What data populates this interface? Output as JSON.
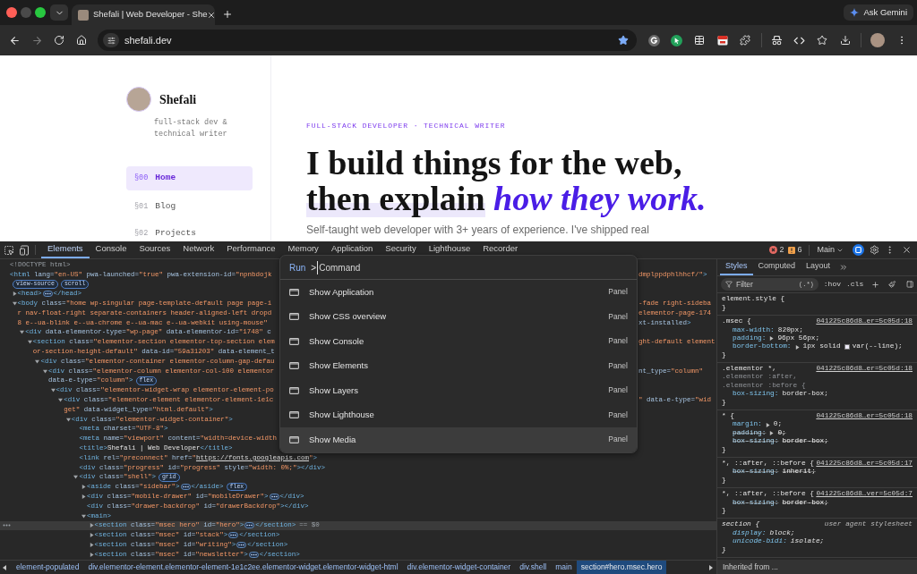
{
  "browser": {
    "tab": {
      "title": "Shefali | Web Developer - She"
    },
    "ask_button": "Ask Gemini",
    "address": "shefali.dev"
  },
  "page": {
    "sidebar": {
      "name": "Shefali",
      "tagline": [
        "full-stack dev &",
        "technical writer"
      ],
      "nav": [
        {
          "number": "§00",
          "label": "Home",
          "selected": true
        },
        {
          "number": "§01",
          "label": "Blog",
          "selected": false
        },
        {
          "number": "§02",
          "label": "Projects",
          "selected": false
        }
      ]
    },
    "hero": {
      "eyebrow": "FULL-STACK DEVELOPER · TECHNICAL WRITER",
      "heading": "I build things for the web,",
      "highlighted": "then explain",
      "emphasis": "how they work.",
      "intro": "Self-taught web developer with 3+ years of experience. I've shipped real"
    }
  },
  "devtools": {
    "tabs": [
      {
        "label": "Elements",
        "selected": true
      },
      {
        "label": "Console",
        "selected": false
      },
      {
        "label": "Sources",
        "selected": false
      },
      {
        "label": "Network",
        "selected": false
      },
      {
        "label": "Performance",
        "selected": false
      },
      {
        "label": "Memory",
        "selected": false
      },
      {
        "label": "Application",
        "selected": false
      },
      {
        "label": "Security",
        "selected": false
      },
      {
        "label": "Lighthouse",
        "selected": false
      },
      {
        "label": "Recorder",
        "selected": false
      }
    ],
    "issues": {
      "errors": "2",
      "warnings": "6"
    },
    "context": "Main",
    "elements": {
      "tree": [
        {
          "lines": [
            {
              "text": "<!DOCTYPE html>",
              "kind": "doctype"
            }
          ],
          "selected": false
        },
        {
          "lines": [
            {
              "text": "<html lang=\"en-US\" pwa-launched=\"true\" pwa-extension-id=\"npnbdojk",
              "kind": "markup",
              "right": {
                "text": "dmplppdphlhhcf/\">",
                "kind": "value"
              }
            },
            {
              "kind": "badges",
              "badges": [
                "view-source",
                "scroll"
              ]
            }
          ],
          "selected": false,
          "children": [
            {
              "lines": [
                {
                  "text": "<head>",
                  "kind": "markup",
                  "ellipsis": true,
                  "after": "</head>"
                }
              ],
              "expanded": false,
              "selected": false
            },
            {
              "lines": [
                {
                  "text": "<body class=\"home wp-singular page-template-default page page-i",
                  "kind": "markup",
                  "right": {
                    "text": "-fade right-sideba",
                    "kind": "value"
                  }
                },
                {
                  "text": "r nav-float-right separate-containers header-aligned-left dropd",
                  "kind": "value",
                  "right": {
                    "text": "elementor-page-174",
                    "kind": "value"
                  }
                },
                {
                  "text": "8 e--ua-blink e--ua-chrome e--ua-mac e--ua-webkit using-mouse\"",
                  "kind": "value",
                  "right": {
                    "text": "xt-installed>",
                    "kind": "attribute"
                  }
                }
              ],
              "expanded": true,
              "selected": false,
              "children": [
                {
                  "lines": [
                    {
                      "text": "<div data-elementor-type=\"wp-page\" data-elementor-id=\"1748\" c",
                      "kind": "markup"
                    }
                  ],
                  "expanded": true,
                  "selected": false,
                  "children": [
                    {
                      "lines": [
                        {
                          "text": "<section class=\"elementor-section elementor-top-section elem",
                          "kind": "markup",
                          "right": {
                            "text": "ght-default element",
                            "kind": "value"
                          }
                        },
                        {
                          "text": "or-section-height-default\" data-id=\"59a31203\" data-element_t",
                          "kind": "value"
                        }
                      ],
                      "expanded": true,
                      "selected": false,
                      "children": [
                        {
                          "lines": [
                            {
                              "text": "<div class=\"elementor-container elementor-column-gap-defau",
                              "kind": "markup"
                            }
                          ],
                          "expanded": true,
                          "selected": false,
                          "children": [
                            {
                              "lines": [
                                {
                                  "text": "<div class=\"elementor-column elementor-col-100 elementor",
                                  "kind": "markup",
                                  "right": {
                                    "text": "nt_type=\"column\"",
                                    "kind": "attribute"
                                  }
                                },
                                {
                                  "text": "data-e-type=\"column\">",
                                  "kind": "attribute",
                                  "badges": [
                                    "flex"
                                  ]
                                }
                              ],
                              "expanded": true,
                              "selected": false,
                              "children": [
                                {
                                  "lines": [
                                    {
                                      "text": "<div class=\"elementor-widget-wrap elementor-element-po",
                                      "kind": "markup"
                                    }
                                  ],
                                  "expanded": true,
                                  "selected": false,
                                  "children": [
                                    {
                                      "lines": [
                                        {
                                          "text": "<div class=\"elementor-element elementor-element-1e1c",
                                          "kind": "markup",
                                          "right": {
                                            "text": "\" data-e-type=\"wid",
                                            "kind": "value"
                                          }
                                        },
                                        {
                                          "text": "get\" data-widget_type=\"html.default\">",
                                          "kind": "value"
                                        }
                                      ],
                                      "expanded": true,
                                      "selected": false,
                                      "children": [
                                        {
                                          "lines": [
                                            {
                                              "text": "<div class=\"elementor-widget-container\">",
                                              "kind": "markup"
                                            }
                                          ],
                                          "expanded": true,
                                          "selected": false,
                                          "children": [
                                            {
                                              "lines": [
                                                {
                                                  "text": "<meta charset=\"UTF-8\">",
                                                  "kind": "markup"
                                                }
                                              ],
                                              "selected": false
                                            },
                                            {
                                              "lines": [
                                                {
                                                  "text": "<meta name=\"viewport\" content=\"width=device-width",
                                                  "kind": "markup"
                                                }
                                              ],
                                              "selected": false
                                            },
                                            {
                                              "lines": [
                                                {
                                                  "text": "<title>Shefali | Web Developer</title>",
                                                  "kind": "markup"
                                                }
                                              ],
                                              "selected": false
                                            },
                                            {
                                              "lines": [
                                                {
                                                  "text": "<link rel=\"preconnect\" href=\"",
                                                  "kind": "markup",
                                                  "link": "https://fonts.googleapis.com",
                                                  "after": "\">"
                                                }
                                              ],
                                              "selected": false
                                            },
                                            {
                                              "lines": [
                                                {
                                                  "text": "<div class=\"progress\" id=\"progress\" style=\"width: 0%;\"></div>",
                                                  "kind": "markup"
                                                }
                                              ],
                                              "selected": false
                                            },
                                            {
                                              "lines": [
                                                {
                                                  "text": "<div class=\"shell\">",
                                                  "kind": "markup",
                                                  "badges": [
                                                    "grid"
                                                  ]
                                                }
                                              ],
                                              "expanded": true,
                                              "selected": false,
                                              "children": [
                                                {
                                                  "lines": [
                                                    {
                                                      "text": "<aside class=\"sidebar\">",
                                                      "kind": "markup",
                                                      "ellipsis": true,
                                                      "after": "</aside>",
                                                      "badges": [
                                                        "flex"
                                                      ]
                                                    }
                                                  ],
                                                  "expanded": false,
                                                  "selected": false
                                                },
                                                {
                                                  "lines": [
                                                    {
                                                      "text": "<div class=\"mobile-drawer\" id=\"mobileDrawer\">",
                                                      "kind": "markup",
                                                      "ellipsis": true,
                                                      "after": "</div>"
                                                    }
                                                  ],
                                                  "expanded": false,
                                                  "selected": false
                                                },
                                                {
                                                  "lines": [
                                                    {
                                                      "text": "<div class=\"drawer-backdrop\" id=\"drawerBackdrop\"></div>",
                                                      "kind": "markup"
                                                    }
                                                  ],
                                                  "selected": false
                                                },
                                                {
                                                  "lines": [
                                                    {
                                                      "text": "<main>",
                                                      "kind": "markup"
                                                    }
                                                  ],
                                                  "expanded": true,
                                                  "selected": false,
                                                  "children": [
                                                    {
                                                      "lines": [
                                                        {
                                                          "text": "<section class=\"msec hero\" id=\"hero\">",
                                                          "kind": "markup",
                                                          "ellipsis": true,
                                                          "after": "</section>",
                                                          "marker": "== $0"
                                                        }
                                                      ],
                                                      "expanded": false,
                                                      "selected": true
                                                    },
                                                    {
                                                      "lines": [
                                                        {
                                                          "text": "<section class=\"msec\" id=\"stack\">",
                                                          "kind": "markup",
                                                          "ellipsis": true,
                                                          "after": "</section>"
                                                        }
                                                      ],
                                                      "expanded": false,
                                                      "selected": false
                                                    },
                                                    {
                                                      "lines": [
                                                        {
                                                          "text": "<section class=\"msec\" id=\"writing\">",
                                                          "kind": "markup",
                                                          "ellipsis": true,
                                                          "after": "</section>"
                                                        }
                                                      ],
                                                      "expanded": false,
                                                      "selected": false
                                                    },
                                                    {
                                                      "lines": [
                                                        {
                                                          "text": "<section class=\"msec\" id=\"newsletter\">",
                                                          "kind": "markup",
                                                          "ellipsis": true,
                                                          "after": "</section>"
                                                        }
                                                      ],
                                                      "expanded": false,
                                                      "selected": false
                                                    }
                                                  ]
                                                }
                                              ]
                                            }
                                          ]
                                        }
                                      ]
                                    }
                                  ]
                                }
                              ]
                            }
                          ]
                        }
                      ]
                    }
                  ]
                }
              ]
            }
          ]
        }
      ],
      "breadcrumbs": [
        {
          "label": "element-populated",
          "selected": false
        },
        {
          "label": "div.elementor-element.elementor-element-1e1c2ee.elementor-widget.elementor-widget-html",
          "selected": false
        },
        {
          "label": "div.elementor-widget-container",
          "selected": false
        },
        {
          "label": "div.shell",
          "selected": false
        },
        {
          "label": "main",
          "selected": false
        },
        {
          "label": "section#hero.msec.hero",
          "selected": true
        }
      ]
    },
    "styles": {
      "tabs": [
        {
          "label": "Styles",
          "selected": true
        },
        {
          "label": "Computed",
          "selected": false
        },
        {
          "label": "Layout",
          "selected": false
        }
      ],
      "filter": {
        "placeholder": "Filter",
        "regex": "(.*)"
      },
      "toggles": [
        ":hov",
        ".cls"
      ],
      "rules": [
        {
          "selector": [
            {
              "text": "element.style {",
              "matched": true
            }
          ],
          "user_agent": false,
          "close": "}"
        },
        {
          "selector": [
            {
              "text": ".msec {",
              "matched": true
            }
          ],
          "source": "041225c86d8…er=5c05d:18",
          "user_agent": false,
          "properties": [
            {
              "name": "max-width:",
              "value": "820px;",
              "shorthand": false,
              "overridden": false
            },
            {
              "name": "padding:",
              "value": "96px 56px;",
              "shorthand": true,
              "overridden": false
            },
            {
              "name": "border-bottom:",
              "value": "1px solid",
              "color": "#ece9f6",
              "variable": "var(--line);",
              "shorthand": true,
              "overridden": false
            }
          ],
          "close": "}"
        },
        {
          "selector": [
            {
              "text": ".elementor *,",
              "matched": true
            },
            {
              "text": ".elementor :after,",
              "matched": false
            },
            {
              "text": ".elementor :before {",
              "matched": false
            }
          ],
          "source": "041225c86d8…er=5c05d:18",
          "user_agent": false,
          "properties": [
            {
              "name": "box-sizing:",
              "value": "border-box;",
              "shorthand": false,
              "overridden": false
            }
          ],
          "close": "}"
        },
        {
          "selector": [
            {
              "text": "* {",
              "matched": true
            }
          ],
          "source": "041225c86d8…er=5c05d:18",
          "user_agent": false,
          "properties": [
            {
              "name": "margin:",
              "value": "0;",
              "shorthand": true,
              "overridden": false
            },
            {
              "name": "padding:",
              "value": "0;",
              "shorthand": true,
              "overridden": true
            },
            {
              "name": "box-sizing:",
              "value": "border-box;",
              "shorthand": false,
              "overridden": true
            }
          ],
          "close": "}"
        },
        {
          "selector": [
            {
              "text": "*, ::after, ::before {",
              "matched": true
            }
          ],
          "source": "041225c86d8…er=5c05d:17",
          "user_agent": false,
          "properties": [
            {
              "name": "box-sizing:",
              "value": "inherit;",
              "shorthand": false,
              "overridden": true
            }
          ],
          "close": "}"
        },
        {
          "selector": [
            {
              "text": "*, ::after, ::before {",
              "matched": true
            }
          ],
          "source": "041225c86d8…ver=5c05d:7",
          "user_agent": false,
          "properties": [
            {
              "name": "box-sizing:",
              "value": "border-box;",
              "shorthand": false,
              "overridden": true
            }
          ],
          "close": "}"
        },
        {
          "selector": [
            {
              "text": "section {",
              "matched": true
            }
          ],
          "source": "user agent stylesheet",
          "user_agent": true,
          "properties": [
            {
              "name": "display:",
              "value": "block;",
              "shorthand": false,
              "overridden": false
            },
            {
              "name": "unicode-bidi:",
              "value": "isolate;",
              "shorthand": false,
              "overridden": false
            }
          ],
          "close": "}"
        }
      ],
      "inherited": "Inherited from ..."
    },
    "command_menu": {
      "prefix": "Run",
      "value": ">",
      "placeholder": "Command",
      "items": [
        {
          "label": "Show Application",
          "category": "Panel",
          "selected": false
        },
        {
          "label": "Show CSS overview",
          "category": "Panel",
          "selected": false
        },
        {
          "label": "Show Console",
          "category": "Panel",
          "selected": false
        },
        {
          "label": "Show Elements",
          "category": "Panel",
          "selected": false
        },
        {
          "label": "Show Layers",
          "category": "Panel",
          "selected": false
        },
        {
          "label": "Show Lighthouse",
          "category": "Panel",
          "selected": false
        },
        {
          "label": "Show Media",
          "category": "Panel",
          "selected": true
        }
      ]
    }
  }
}
